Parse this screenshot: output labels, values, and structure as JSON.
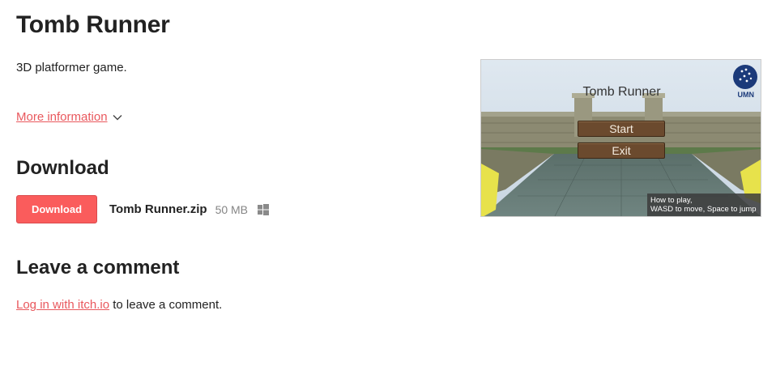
{
  "game": {
    "title": "Tomb Runner",
    "description": "3D platformer game.",
    "more_info_label": "More information"
  },
  "download": {
    "heading": "Download",
    "button_label": "Download",
    "file_name": "Tomb Runner.zip",
    "file_size": "50 MB",
    "platform_icon": "windows-icon"
  },
  "comments": {
    "heading": "Leave a comment",
    "login_link": "Log in with itch.io",
    "suffix": " to leave a comment."
  },
  "screenshot": {
    "title": "Tomb Runner",
    "start_label": "Start",
    "exit_label": "Exit",
    "logo_text": "UMN",
    "help_line1": "How to play,",
    "help_line2": "WASD to move, Space to jump"
  },
  "colors": {
    "accent": "#fa5c5c",
    "link": "#e9585d",
    "muted": "#858585"
  }
}
